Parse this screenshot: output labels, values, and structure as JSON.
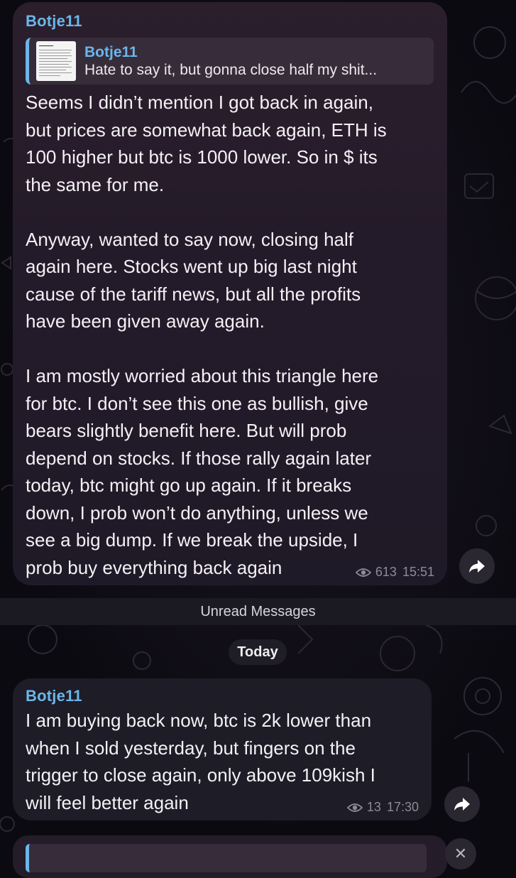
{
  "messages": [
    {
      "sender": "Botje11",
      "reply": {
        "sender": "Botje11",
        "snippet": "Hate to say it, but gonna close half my shit..."
      },
      "text": "Seems I didn’t mention I got back in again,\nbut prices are somewhat back again, ETH is\n100 higher but btc is 1000 lower. So in $ its\nthe same for me.\n\nAnyway, wanted to say now, closing half\nagain here. Stocks went up big last night\ncause of the tariff news, but all the profits\nhave been given away again.\n\nI am mostly worried about this triangle here\nfor btc. I don’t see this one as bullish, give\nbears slightly benefit here. But will prob\ndepend on stocks. If those rally again later\ntoday, btc might go up again. If it breaks\ndown, I prob won’t do anything, unless we\nsee a big dump. If we break the upside, I\nprob buy everything back again",
      "views": "613",
      "time": "15:51"
    },
    {
      "sender": "Botje11",
      "text": "I am buying back now, btc is 2k lower than\nwhen I sold yesterday, but fingers on the\ntrigger to close again, only above 109kish I\nwill feel better again",
      "views": "13",
      "time": "17:30"
    }
  ],
  "separators": {
    "unread": "Unread Messages",
    "date": "Today"
  },
  "icons": {
    "views": "eye-icon",
    "share": "share-arrow-icon",
    "close": "close-icon"
  },
  "colors": {
    "accent": "#6bb6ea",
    "text": "#f4f1f5",
    "meta": "#8e8a96",
    "bubble": "#241b2a"
  }
}
